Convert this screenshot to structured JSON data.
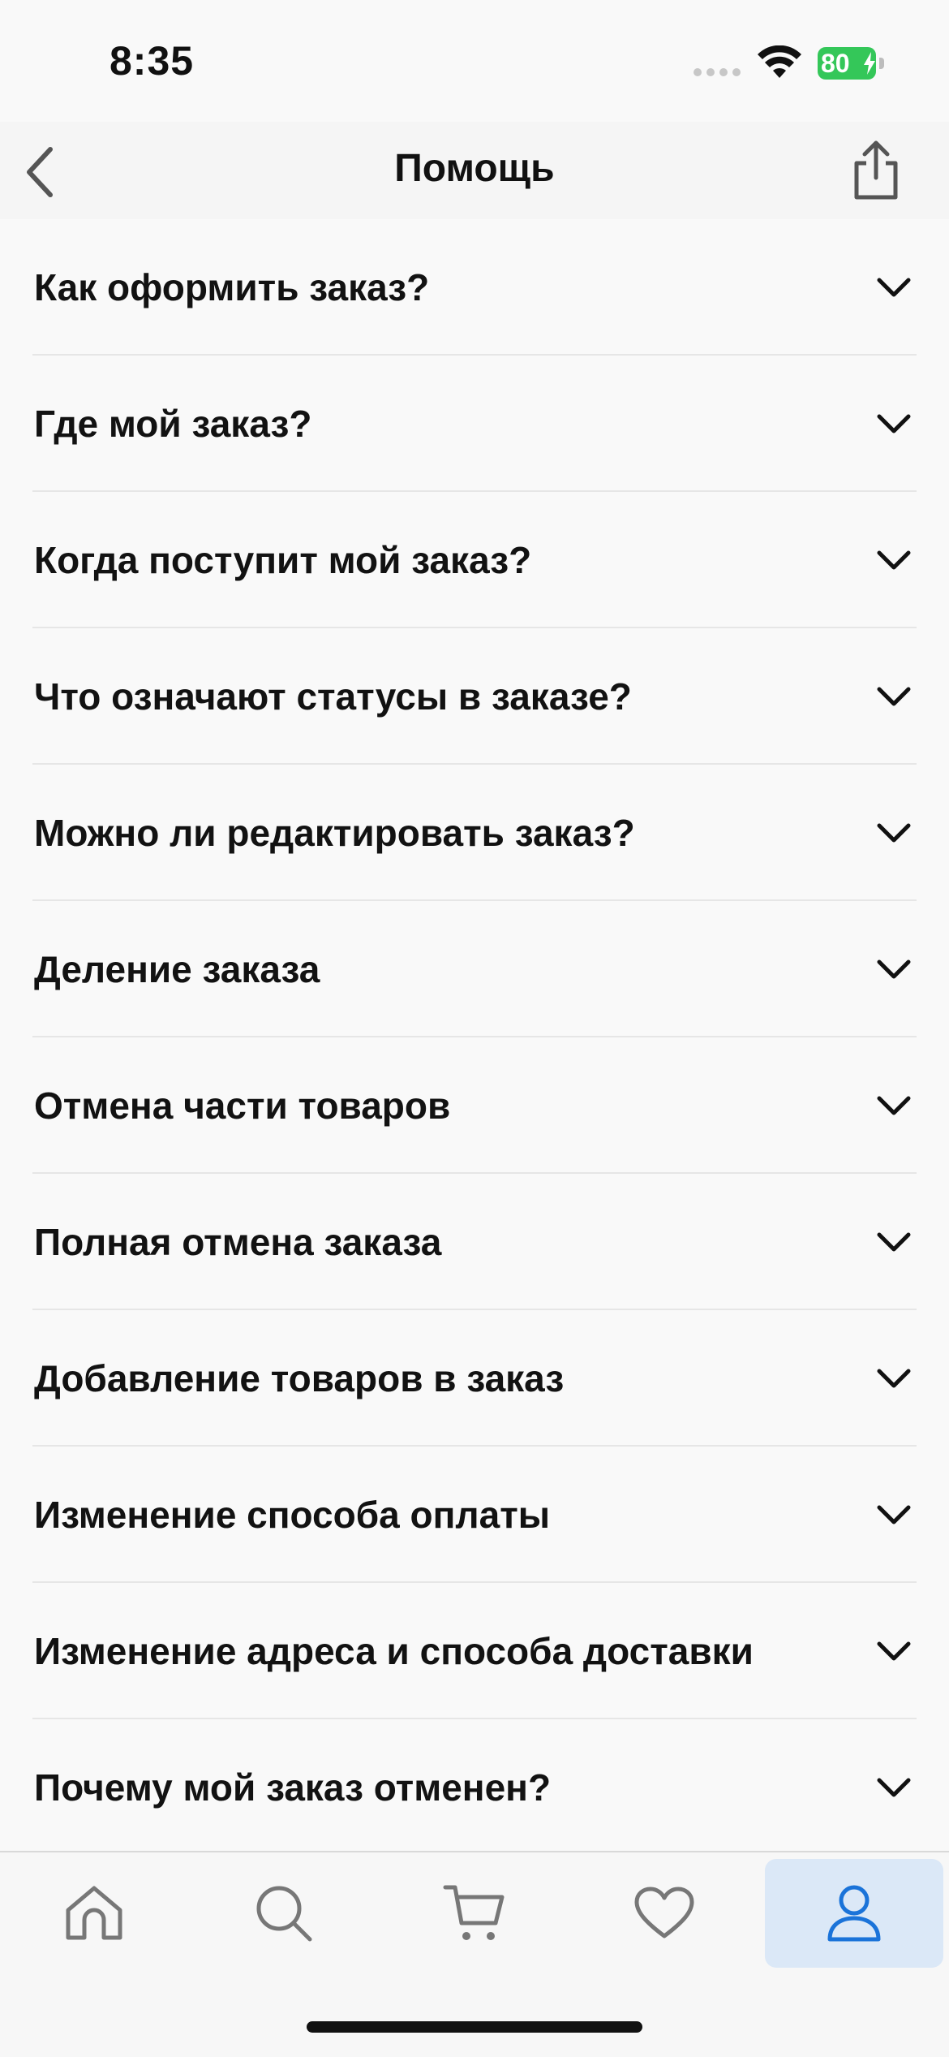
{
  "status_bar": {
    "time": "8:35",
    "battery_level": "80",
    "battery_color": "#34c759"
  },
  "header": {
    "title": "Помощь",
    "back_icon": "chevron-left-icon",
    "share_icon": "share-icon"
  },
  "faq": [
    {
      "label": "Как оформить заказ?"
    },
    {
      "label": "Где мой заказ?"
    },
    {
      "label": "Когда поступит мой заказ?"
    },
    {
      "label": "Что означают статусы в заказе?"
    },
    {
      "label": "Можно ли редактировать заказ?"
    },
    {
      "label": "Деление заказа"
    },
    {
      "label": "Отмена части товаров"
    },
    {
      "label": "Полная отмена заказа"
    },
    {
      "label": "Добавление товаров в заказ"
    },
    {
      "label": "Изменение способа оплаты"
    },
    {
      "label": "Изменение адреса и способа доставки"
    },
    {
      "label": "Почему мой заказ отменен?"
    }
  ],
  "tab_bar": {
    "tabs": [
      {
        "name": "home",
        "icon": "home-icon"
      },
      {
        "name": "search",
        "icon": "search-icon"
      },
      {
        "name": "cart",
        "icon": "cart-icon"
      },
      {
        "name": "favorites",
        "icon": "heart-icon"
      },
      {
        "name": "profile",
        "icon": "user-icon",
        "active": true
      }
    ],
    "active_color": "#1a73d9",
    "active_bg": "#dbe8f7"
  }
}
